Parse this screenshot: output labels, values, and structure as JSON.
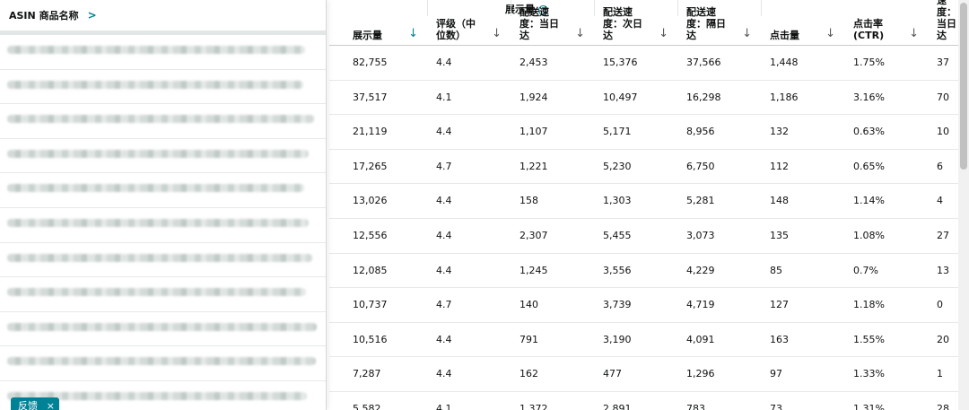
{
  "left_panel": {
    "header_label": "ASIN 商品名称",
    "row_count": 11,
    "feedback_label": "反馈",
    "feedback_close": "×"
  },
  "table": {
    "group_header": "展示量",
    "group_help": "?",
    "columns": [
      {
        "label": "展示量",
        "sort": "↓",
        "active": true
      },
      {
        "label": "评级（中位数）",
        "sort": "↓"
      },
      {
        "label": "配送速度：当日达",
        "sort": "↓"
      },
      {
        "label": "配送速度：次日达",
        "sort": "↓"
      },
      {
        "label": "配送速度：隔日达",
        "sort": "↓"
      },
      {
        "label": "点击量",
        "sort": "↓"
      },
      {
        "label": "点击率 (CTR)",
        "sort": "↓"
      },
      {
        "label": "配送速度：当日达",
        "sort": ""
      }
    ],
    "rows": [
      [
        "82,755",
        "4.4",
        "2,453",
        "15,376",
        "37,566",
        "1,448",
        "1.75%",
        "37"
      ],
      [
        "37,517",
        "4.1",
        "1,924",
        "10,497",
        "16,298",
        "1,186",
        "3.16%",
        "70"
      ],
      [
        "21,119",
        "4.4",
        "1,107",
        "5,171",
        "8,956",
        "132",
        "0.63%",
        "10"
      ],
      [
        "17,265",
        "4.7",
        "1,221",
        "5,230",
        "6,750",
        "112",
        "0.65%",
        "6"
      ],
      [
        "13,026",
        "4.4",
        "158",
        "1,303",
        "5,281",
        "148",
        "1.14%",
        "4"
      ],
      [
        "12,556",
        "4.4",
        "2,307",
        "5,455",
        "3,073",
        "135",
        "1.08%",
        "27"
      ],
      [
        "12,085",
        "4.4",
        "1,245",
        "3,556",
        "4,229",
        "85",
        "0.7%",
        "13"
      ],
      [
        "10,737",
        "4.7",
        "140",
        "3,739",
        "4,719",
        "127",
        "1.18%",
        "0"
      ],
      [
        "10,516",
        "4.4",
        "791",
        "3,190",
        "4,091",
        "163",
        "1.55%",
        "20"
      ],
      [
        "7,287",
        "4.4",
        "162",
        "477",
        "1,296",
        "97",
        "1.33%",
        "1"
      ],
      [
        "5,582",
        "4.1",
        "1,372",
        "2,891",
        "783",
        "73",
        "1.31%",
        "28"
      ]
    ]
  },
  "colors": {
    "accent": "#008296",
    "header_border": "#c9cccc",
    "row_border": "#e7e9e9"
  }
}
